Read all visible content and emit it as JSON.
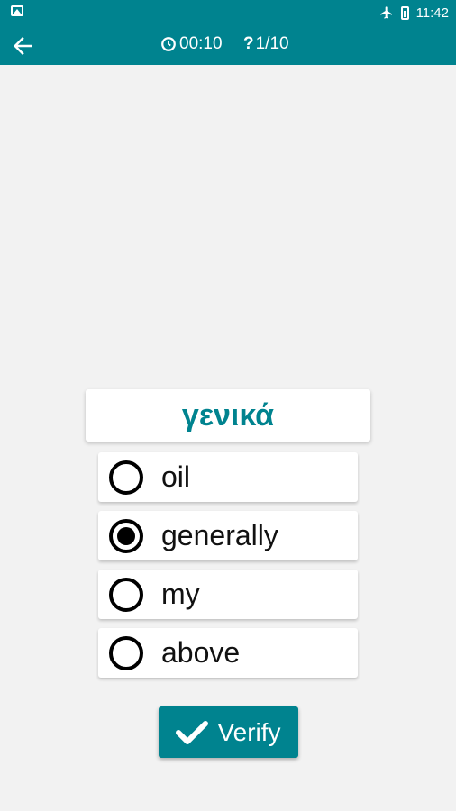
{
  "status_bar": {
    "time": "11:42",
    "icons": [
      "image-icon",
      "airplane-icon",
      "battery-icon"
    ]
  },
  "app_bar": {
    "back_icon": "arrow-left-icon",
    "timer": "00:10",
    "question_progress": "1/10"
  },
  "quiz": {
    "word": "γενικά",
    "options": [
      {
        "label": "oil",
        "selected": false
      },
      {
        "label": "generally",
        "selected": true
      },
      {
        "label": "my",
        "selected": false
      },
      {
        "label": "above",
        "selected": false
      }
    ],
    "verify_label": "Verify"
  },
  "colors": {
    "primary": "#00838f",
    "background": "#f2f2f2",
    "card": "#ffffff"
  }
}
